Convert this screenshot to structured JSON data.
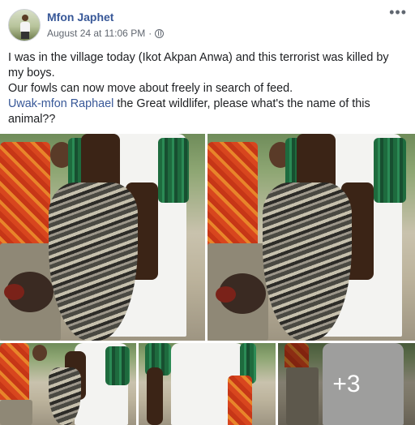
{
  "post": {
    "author": "Mfon Japhet",
    "timestamp": "August 24 at 11:06 PM",
    "separator": "·",
    "privacy_icon": "globe-icon",
    "more_label": "•••",
    "line1": "I was in the village today (Ikot Akpan Anwa) and this terrorist was killed by my boys.",
    "line2": "Our fowls can now move about freely in search of feed.",
    "mention": "Uwak-mfon Raphael",
    "line3_rest": " the Great wildlifer, please what's the name of this animal??"
  },
  "photos": {
    "more_count": "+3"
  },
  "colors": {
    "link": "#385898",
    "meta": "#616770",
    "text": "#1c1e21"
  }
}
